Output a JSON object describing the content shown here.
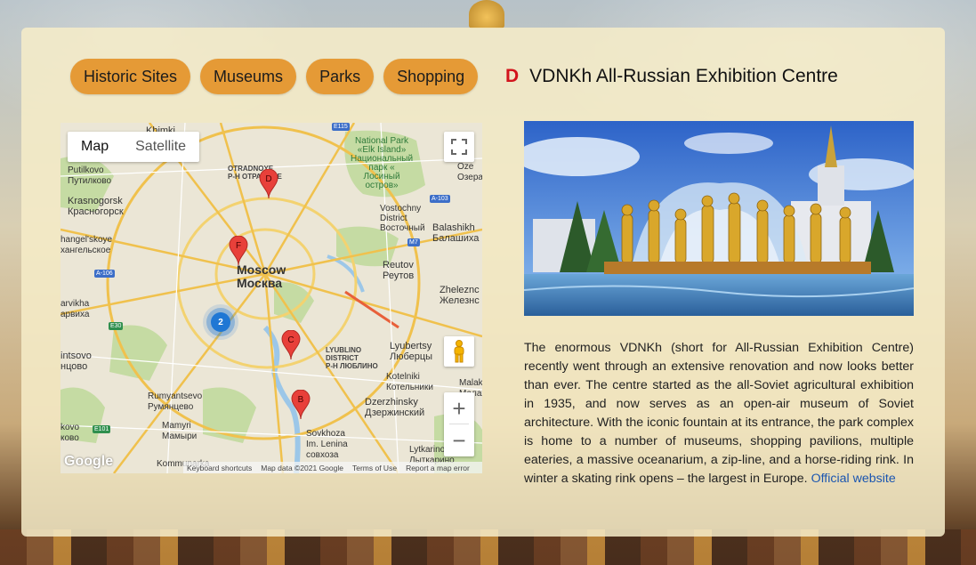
{
  "categories": [
    "Historic Sites",
    "Museums",
    "Parks",
    "Shopping"
  ],
  "selected": {
    "letter": "D",
    "title": "VDNKh All-Russian Exhibition Centre",
    "description": "The enormous VDNKh (short for All-Russian Exhibition Centre) recently went through an extensive renovation and now looks better than ever. The centre started as the all-Soviet agricultural exhibition in 1935, and now serves as an open-air museum of Soviet architecture. With the iconic fountain at its entrance, the park complex is home to a number of museums, shopping pavilions, multiple eateries, a massive oceanarium, a zip-line, and a horse-riding rink. In winter a skating rink opens – the largest in Europe.",
    "link_label": "Official website"
  },
  "map": {
    "type_options": [
      "Map",
      "Satellite"
    ],
    "active_type": "Map",
    "zoom_in": "+",
    "zoom_out": "−",
    "cluster_count": "2",
    "markers": [
      "D",
      "F",
      "C",
      "B"
    ],
    "labels": {
      "khimki": "Khimki",
      "krasnogorsk": "Krasnogorsk\nКрасногорск",
      "otradnoye": "OTRADNOYE\nР-Н ОТРАДНОЕ",
      "putilkovo": "Putilkovo\nПутилково",
      "national_park": "National Park\n«Elk Island»\nНациональный\nпарк «\nЛосиный\nостров»",
      "oze": "Oze\nОзера",
      "vostochny": "Vostochny\nDistrict\nВосточный",
      "balashikha": "Balashikh\nБалашиха",
      "angelskoye": "hangel'skoye\nхангельское",
      "moscow": "Moscow\nМосква",
      "reutov": "Reutov\nРеутов",
      "zheleznod": "Zheleznc\nЖелезнс",
      "barvikha": "arvikha\nарвиха",
      "vnukovo": "intsovo\nнцово",
      "lyublino": "LYUBLINO\nDISTRICT\nР-Н ЛЮБЛИНО",
      "lyubertsy": "Lyubertsy\nЛюберцы",
      "kotelniki": "Kotelniki\nКотельники",
      "malak": "Malak\nМалах",
      "rumyantsevo": "Rumyantsevo\nРумянцево",
      "dzerzhinsky": "Dzerzhinsky\nДзержинский",
      "mamyri": "Mamyri\nМамыри",
      "sovkhoza": "Sovkhoza\nIm. Lenina\nсовхоза",
      "lytkarino": "Lytkarino\nЛыткарино",
      "kokovo": "kovo\nково",
      "kommunarka": "Kommunarka"
    },
    "shields": [
      "E115",
      "A-103",
      "M7",
      "A-106",
      "E30",
      "E101"
    ],
    "footer": {
      "logo": "Google",
      "keyboard": "Keyboard shortcuts",
      "data": "Map data ©2021 Google",
      "terms": "Terms of Use",
      "report": "Report a map error"
    }
  },
  "colors": {
    "tab_bg": "#e59a36",
    "marker_red": "#e8403a",
    "link": "#1a55b0",
    "panel": "#f6ecc8"
  }
}
